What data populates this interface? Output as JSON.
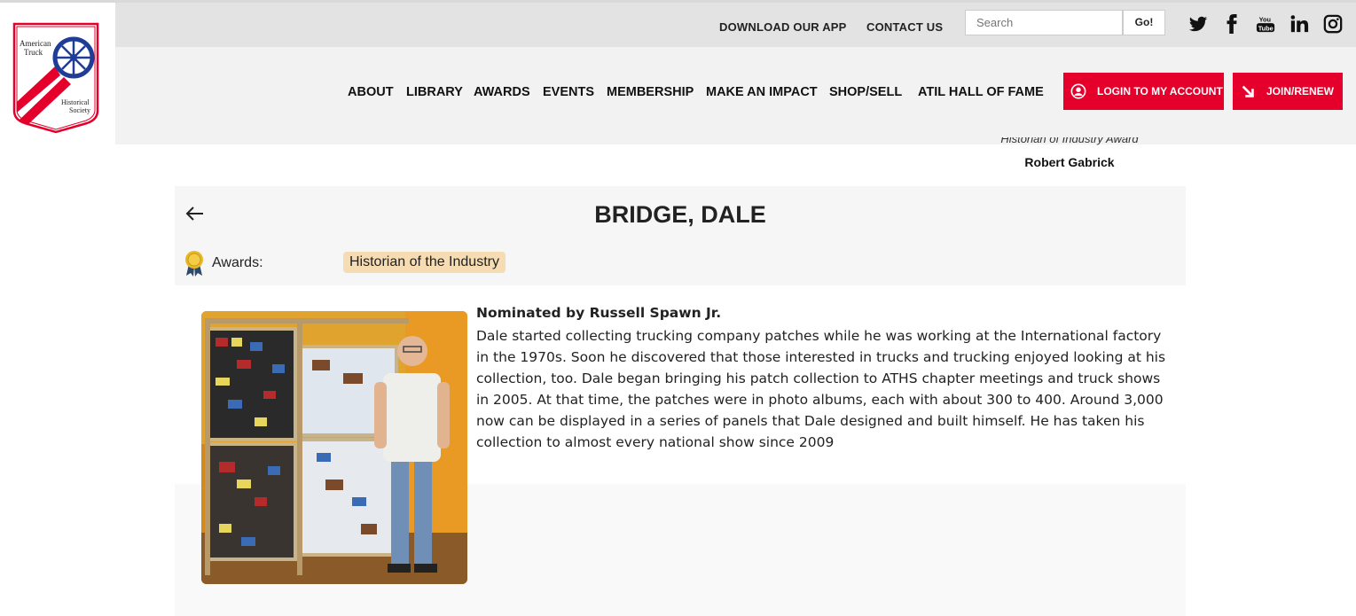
{
  "header": {
    "logo_text": [
      "American",
      "Truck",
      "Historical",
      "Society"
    ],
    "utility_links": [
      "DOWNLOAD OUR APP",
      "CONTACT US"
    ],
    "search": {
      "placeholder": "Search",
      "button": "Go!"
    },
    "social_icons": [
      "twitter-icon",
      "facebook-icon",
      "youtube-icon",
      "linkedin-icon",
      "instagram-icon"
    ],
    "youtube_text": [
      "You",
      "Tube"
    ],
    "nav": [
      "ABOUT",
      "LIBRARY",
      "AWARDS",
      "EVENTS",
      "MEMBERSHIP",
      "MAKE AN IMPACT",
      "SHOP/SELL",
      "ATIL HALL OF FAME"
    ],
    "login_label": "LOGIN TO MY ACCOUNT",
    "join_label": "JOIN/RENEW"
  },
  "peek": {
    "award": "Historian of Industry Award",
    "name": "Robert Gabrick"
  },
  "profile": {
    "name": "BRIDGE, DALE",
    "awards_label": "Awards:",
    "award": "Historian of the Industry",
    "nominator": "Nominated by Russell Spawn Jr.",
    "bio": "Dale started collecting trucking company patches while he was working at the International factory in the 1970s. Soon he discovered that those interested in trucks and trucking enjoyed looking at his collection, too. Dale began bringing his patch collection to ATHS chapter meetings and truck shows in 2005. At that time, the patches were in photo albums, each with about 300 to 400. Around 3,000 now can be displayed in a series of panels that Dale designed and built himself. He has taken his collection to almost every national show since 2009"
  },
  "colors": {
    "brand_red": "#e4002b",
    "badge_bg": "#f6dcb3",
    "logo_blue": "#1f3c96"
  }
}
